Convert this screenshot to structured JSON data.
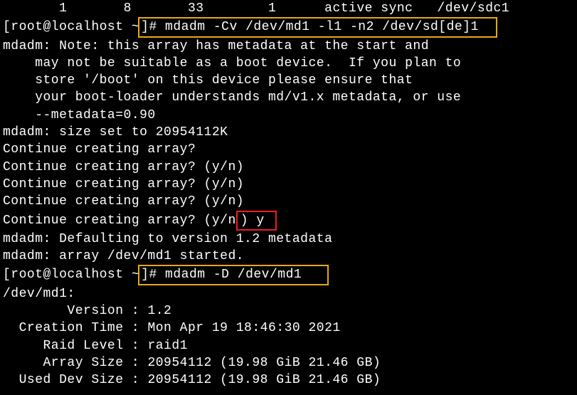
{
  "header": {
    "col1": "1",
    "col2": "8",
    "col3": "33",
    "col4": "1",
    "col5": "active sync",
    "col6": "/dev/sdc1"
  },
  "prompt1": {
    "prefix": "[root@localhost ~",
    "cmd": "]# mdadm -Cv /dev/md1 -l1 -n2 /dev/sd[de]1"
  },
  "output": {
    "note1": "mdadm: Note: this array has metadata at the start and",
    "note2": "    may not be suitable as a boot device.  If you plan to",
    "note3": "    store '/boot' on this device please ensure that",
    "note4": "    your boot-loader understands md/v1.x metadata, or use",
    "note5": "    --metadata=0.90",
    "size": "mdadm: size set to 20954112K",
    "q1": "Continue creating array?",
    "q2": "Continue creating array? (y/n)",
    "q3": "Continue creating array? (y/n)",
    "q4": "Continue creating array? (y/n)",
    "q5_prefix": "Continue creating array? (y/n",
    "q5_answer": ") y ",
    "default": "mdadm: Defaulting to version 1.2 metadata",
    "started": "mdadm: array /dev/md1 started."
  },
  "prompt2": {
    "prefix": "[root@localhost ~",
    "cmd": "]# mdadm -D /dev/md1"
  },
  "detail": {
    "header": "/dev/md1:",
    "version_label": "        Version : ",
    "version_value": "1.2",
    "creation_label": "  Creation Time : ",
    "creation_value": "Mon Apr 19 18:46:30 2021",
    "raid_label": "     Raid Level : ",
    "raid_value": "raid1",
    "arraysize_label": "     Array Size : ",
    "arraysize_value": "20954112 (19.98 GiB 21.46 GB)",
    "useddev_label": "  Used Dev Size : ",
    "useddev_value": "20954112 (19.98 GiB 21.46 GB)"
  }
}
